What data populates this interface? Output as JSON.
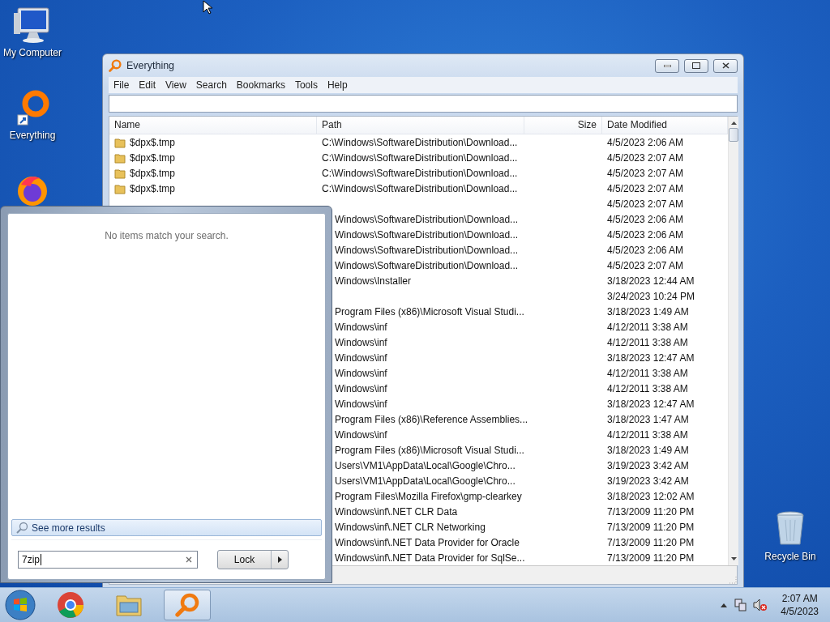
{
  "desktop": {
    "icons": [
      {
        "kind": "computer",
        "label": "My Computer"
      },
      {
        "kind": "everything",
        "label": "Everything"
      },
      {
        "kind": "firefox"
      },
      {
        "kind": "recycle",
        "label": "Recycle Bin"
      }
    ]
  },
  "window": {
    "title": "Everything",
    "menu": [
      "File",
      "Edit",
      "View",
      "Search",
      "Bookmarks",
      "Tools",
      "Help"
    ],
    "table": {
      "columns": [
        "Name",
        "Path",
        "Size",
        "Date Modified"
      ],
      "rows": [
        {
          "kind": "full",
          "name": "$dpx$.tmp",
          "path": "C:\\Windows\\SoftwareDistribution\\Download...",
          "date": "4/5/2023 2:06 AM"
        },
        {
          "kind": "full",
          "name": "$dpx$.tmp",
          "path": "C:\\Windows\\SoftwareDistribution\\Download...",
          "date": "4/5/2023 2:07 AM"
        },
        {
          "kind": "full",
          "name": "$dpx$.tmp",
          "path": "C:\\Windows\\SoftwareDistribution\\Download...",
          "date": "4/5/2023 2:07 AM"
        },
        {
          "kind": "full",
          "name": "$dpx$.tmp",
          "path": "C:\\Windows\\SoftwareDistribution\\Download...",
          "date": "4/5/2023 2:07 AM"
        },
        {
          "kind": "covered",
          "date": "4/5/2023 2:07 AM"
        },
        {
          "kind": "covered",
          "path": "Windows\\SoftwareDistribution\\Download...",
          "date": "4/5/2023 2:06 AM"
        },
        {
          "kind": "covered",
          "path": "Windows\\SoftwareDistribution\\Download...",
          "date": "4/5/2023 2:06 AM"
        },
        {
          "kind": "covered",
          "path": "Windows\\SoftwareDistribution\\Download...",
          "date": "4/5/2023 2:06 AM"
        },
        {
          "kind": "covered",
          "path": "Windows\\SoftwareDistribution\\Download...",
          "date": "4/5/2023 2:07 AM"
        },
        {
          "kind": "covered",
          "path": "Windows\\Installer",
          "date": "3/18/2023 12:44 AM"
        },
        {
          "kind": "covered",
          "date": "3/24/2023 10:24 PM"
        },
        {
          "kind": "covered",
          "path": "Program Files (x86)\\Microsoft Visual Studi...",
          "date": "3/18/2023 1:49 AM"
        },
        {
          "kind": "covered",
          "path": "Windows\\inf",
          "date": "4/12/2011 3:38 AM"
        },
        {
          "kind": "covered",
          "path": "Windows\\inf",
          "date": "4/12/2011 3:38 AM"
        },
        {
          "kind": "covered",
          "path": "Windows\\inf",
          "date": "3/18/2023 12:47 AM"
        },
        {
          "kind": "covered",
          "path": "Windows\\inf",
          "date": "4/12/2011 3:38 AM"
        },
        {
          "kind": "covered",
          "path": "Windows\\inf",
          "date": "4/12/2011 3:38 AM"
        },
        {
          "kind": "covered",
          "path": "Windows\\inf",
          "date": "3/18/2023 12:47 AM"
        },
        {
          "kind": "covered",
          "path": "Program Files (x86)\\Reference Assemblies...",
          "date": "3/18/2023 1:47 AM"
        },
        {
          "kind": "covered",
          "path": "Windows\\inf",
          "date": "4/12/2011 3:38 AM"
        },
        {
          "kind": "covered",
          "path": "Program Files (x86)\\Microsoft Visual Studi...",
          "date": "3/18/2023 1:49 AM"
        },
        {
          "kind": "covered",
          "path": "Users\\VM1\\AppData\\Local\\Google\\Chro...",
          "date": "3/19/2023 3:42 AM"
        },
        {
          "kind": "covered",
          "path": "Users\\VM1\\AppData\\Local\\Google\\Chro...",
          "date": "3/19/2023 3:42 AM"
        },
        {
          "kind": "covered",
          "path": "Program Files\\Mozilla Firefox\\gmp-clearkey",
          "date": "3/18/2023 12:02 AM"
        },
        {
          "kind": "covered",
          "path": "Windows\\inf\\.NET CLR Data",
          "date": "7/13/2009 11:20 PM"
        },
        {
          "kind": "covered",
          "path": "Windows\\inf\\.NET CLR Networking",
          "date": "7/13/2009 11:20 PM"
        },
        {
          "kind": "covered",
          "path": "Windows\\inf\\.NET Data Provider for Oracle",
          "date": "7/13/2009 11:20 PM"
        },
        {
          "kind": "covered",
          "path": "Windows\\inf\\.NET Data Provider for SqlSe...",
          "date": "7/13/2009 11:20 PM"
        }
      ]
    }
  },
  "start_menu": {
    "message": "No items match your search.",
    "see_more": "See more results",
    "search": {
      "value": "7zip"
    },
    "power_button": "Lock"
  },
  "taskbar": {
    "apps": [
      {
        "kind": "chrome",
        "selected": false
      },
      {
        "kind": "explorer",
        "selected": false
      },
      {
        "kind": "everything",
        "selected": true
      }
    ],
    "clock": {
      "time": "2:07 AM",
      "date": "4/5/2023"
    }
  }
}
